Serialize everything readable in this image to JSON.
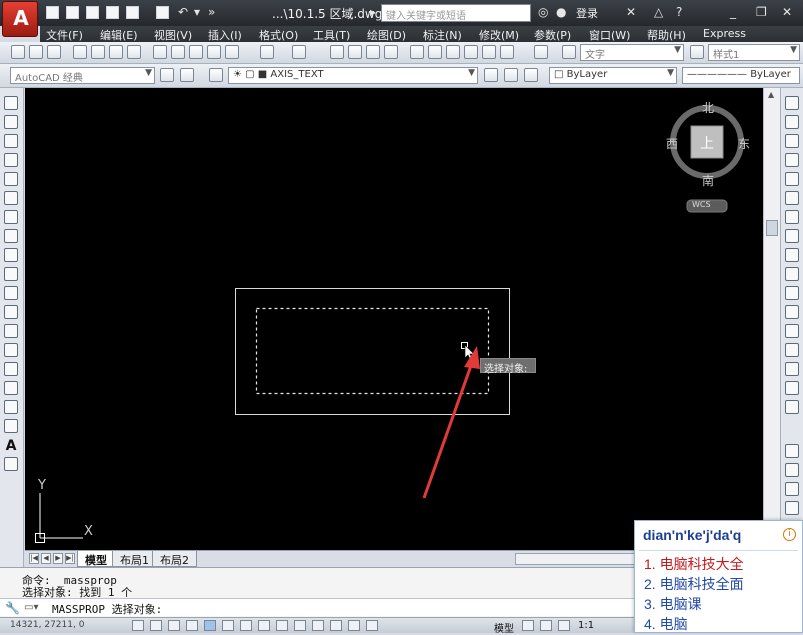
{
  "title_bar": {
    "document_title": "...\\10.1.5 区域.dwg",
    "search_placeholder": "键入关键字或短语",
    "login_label": "登录",
    "app_logo": "A"
  },
  "menu": {
    "items": [
      "文件(F)",
      "编辑(E)",
      "视图(V)",
      "插入(I)",
      "格式(O)",
      "工具(T)",
      "绘图(D)",
      "标注(N)",
      "修改(M)",
      "参数(P)",
      "窗口(W)",
      "帮助(H)",
      "Express"
    ]
  },
  "toolbar1": {
    "text_style_combo": "文字",
    "dim_style_combo": "样式1"
  },
  "toolbar2": {
    "workspace_combo": "AutoCAD 经典",
    "layer_combo": "AXIS_TEXT",
    "color_combo": "ByLayer",
    "linetype_combo": "ByLayer"
  },
  "viewcube": {
    "north": "北",
    "south": "南",
    "east": "东",
    "west": "西",
    "top_face": "上",
    "wcs_label": "WCS"
  },
  "canvas": {
    "tooltip": "选择对象:",
    "ucs_x": "X",
    "ucs_y": "Y"
  },
  "layout_tabs": {
    "tabs": [
      "模型",
      "布局1",
      "布局2"
    ],
    "active": "模型"
  },
  "command_area": {
    "history": [
      "命令: _massprop",
      "选择对象: 找到 1 个"
    ],
    "prompt": "MASSPROP 选择对象:"
  },
  "status_bar": {
    "coordinates": "14321, 27211, 0",
    "model_label": "模型",
    "scale_label": "1:1"
  },
  "ime_popup": {
    "input": "dian'n'ke'j'da'q",
    "info_glyph": "i",
    "candidates": [
      "1. 电脑科技大全",
      "2. 电脑科技全面",
      "3. 电脑课",
      "4. 电脑"
    ]
  },
  "colors": {
    "canvas_bg": "#000000",
    "arrow": "#e03a3a",
    "ime_text": "#2149a8",
    "ime_first": "#c41a1a"
  }
}
